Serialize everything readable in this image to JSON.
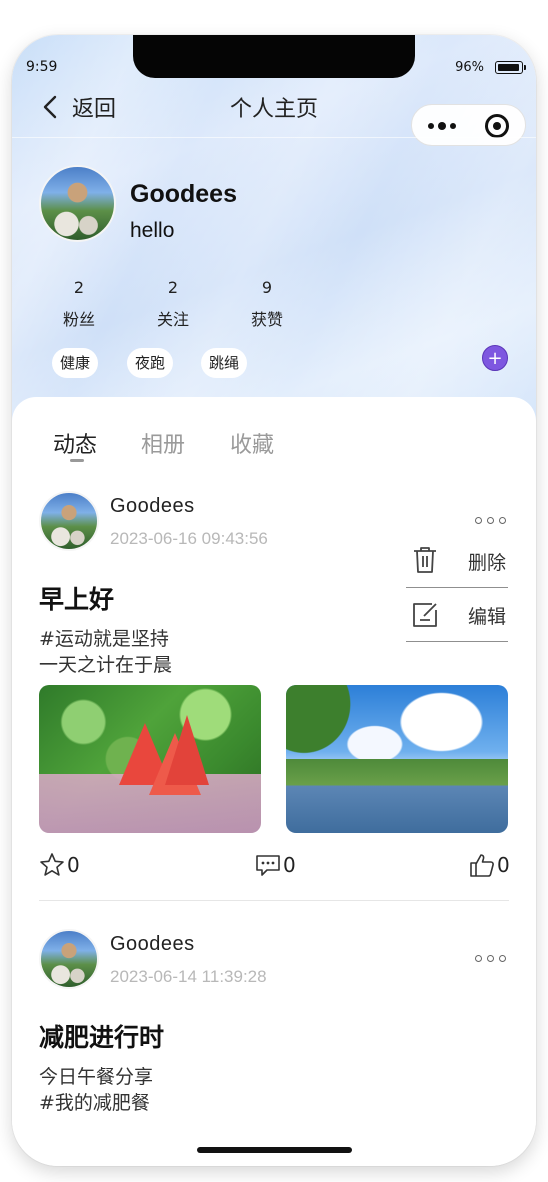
{
  "status_bar": {
    "time": "9:59",
    "battery_percent": "96%",
    "battery_level": 0.96
  },
  "nav": {
    "back_label": "返回",
    "title": "个人主页"
  },
  "profile": {
    "name": "Goodees",
    "bio": "hello"
  },
  "stats": [
    {
      "value": "2",
      "label": "粉丝"
    },
    {
      "value": "2",
      "label": "关注"
    },
    {
      "value": "9",
      "label": "获赞"
    }
  ],
  "tags": [
    "健康",
    "夜跑",
    "跳绳"
  ],
  "add_tag_symbol": "+",
  "tabs": [
    {
      "label": "动态",
      "active": true
    },
    {
      "label": "相册",
      "active": false
    },
    {
      "label": "收藏",
      "active": false
    }
  ],
  "posts": [
    {
      "user": "Goodees",
      "time": "2023-06-16 09:43:56",
      "title": "早上好",
      "lines": [
        "#运动就是坚持",
        "一天之计在于晨"
      ],
      "stars": "0",
      "comments": "0",
      "likes": "0"
    },
    {
      "user": "Goodees",
      "time": "2023-06-14 11:39:28",
      "title": "减肥进行时",
      "lines": [
        "今日午餐分享",
        "#我的减肥餐"
      ]
    }
  ],
  "post_menu": {
    "delete_label": "删除",
    "edit_label": "编辑"
  },
  "colors": {
    "accent_purple": "#7e57e0",
    "hero_blue": "#cfe0f8",
    "muted_text": "#b8b8b8"
  }
}
